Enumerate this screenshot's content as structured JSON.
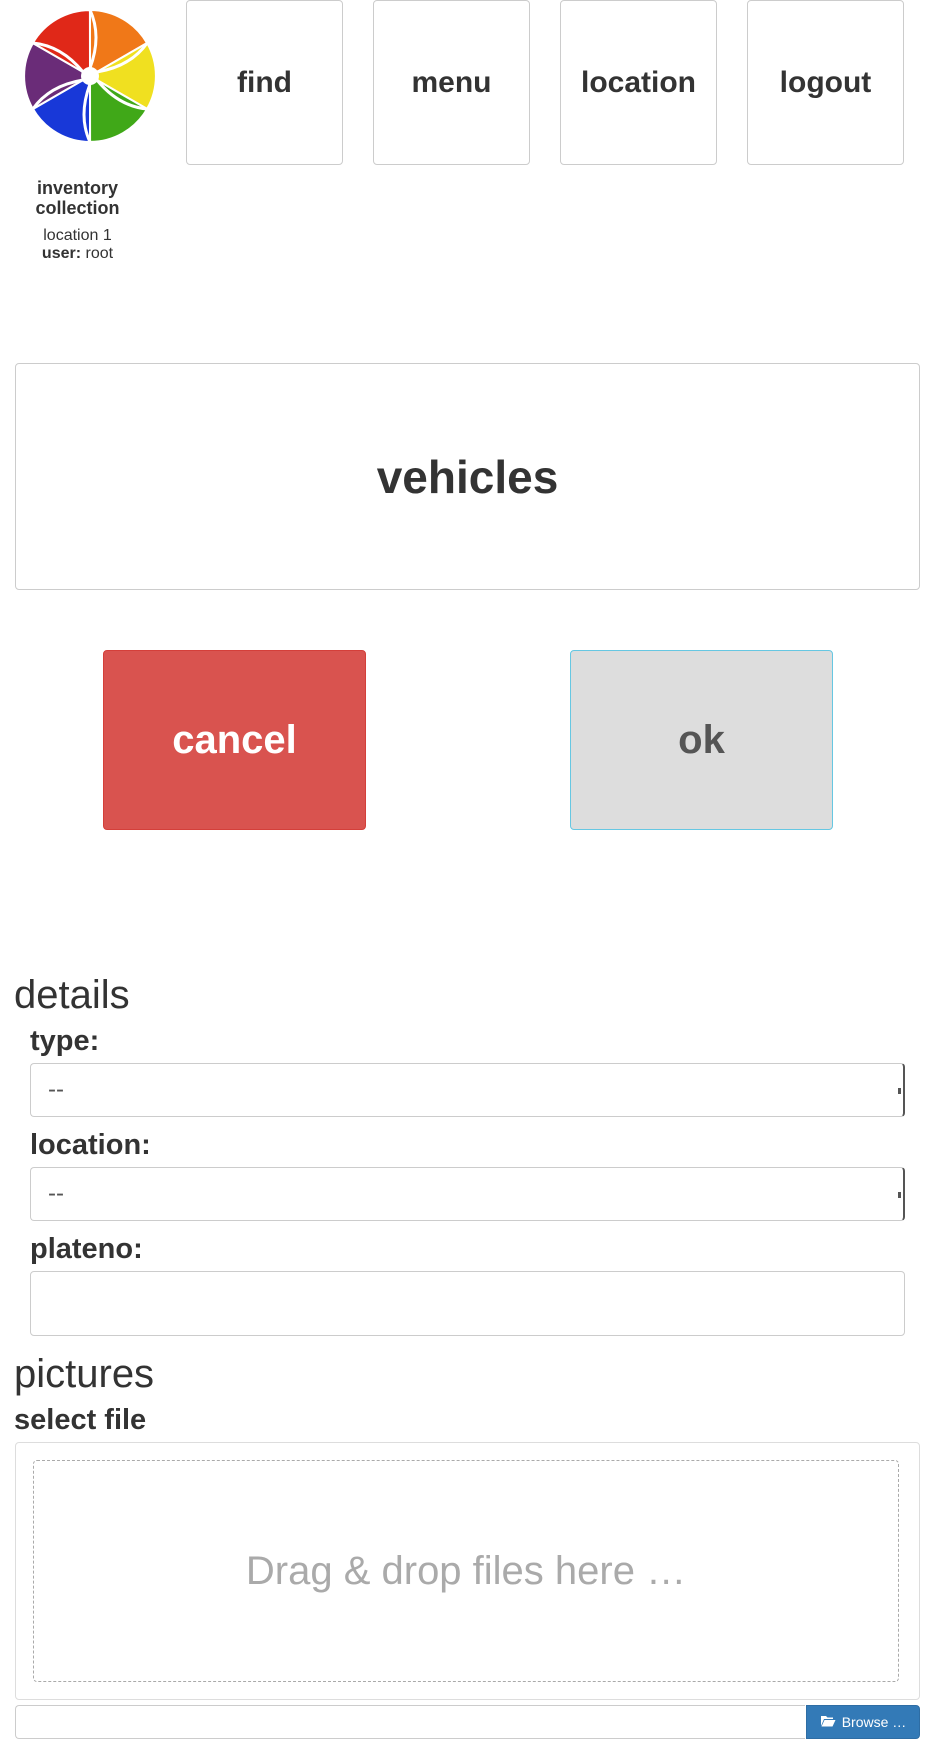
{
  "header": {
    "app_name": "inventory collection",
    "location": "location 1",
    "user_label": "user:",
    "user_value": "root"
  },
  "nav": [
    {
      "label": "find"
    },
    {
      "label": "menu"
    },
    {
      "label": "location"
    },
    {
      "label": "logout"
    }
  ],
  "page_title": "vehicles",
  "actions": {
    "cancel_label": "cancel",
    "ok_label": "ok",
    "cancel_color": "#d9534f",
    "ok_color": "#dddddd"
  },
  "details": {
    "heading": "details",
    "type_label": "type:",
    "type_value": "--",
    "location_label": "location:",
    "location_value": "--",
    "plateno_label": "plateno:",
    "plateno_value": ""
  },
  "pictures": {
    "heading": "pictures",
    "select_file_label": "select file",
    "drop_text": "Drag & drop files here …",
    "browse_label": "Browse …",
    "browse_color": "#337ab7"
  },
  "icons": {
    "logo": "pinwheel-logo",
    "browse": "folder-open-icon"
  }
}
